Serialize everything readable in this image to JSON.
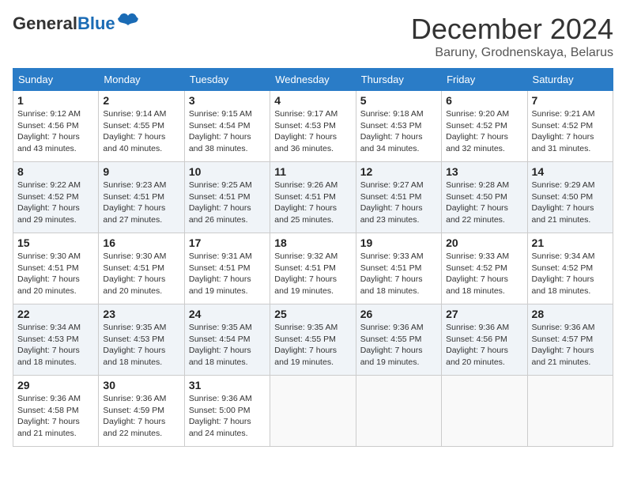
{
  "header": {
    "logo_general": "General",
    "logo_blue": "Blue",
    "month_title": "December 2024",
    "subtitle": "Baruny, Grodnenskaya, Belarus"
  },
  "days_of_week": [
    "Sunday",
    "Monday",
    "Tuesday",
    "Wednesday",
    "Thursday",
    "Friday",
    "Saturday"
  ],
  "weeks": [
    [
      {
        "day": "1",
        "sunrise": "9:12 AM",
        "sunset": "4:56 PM",
        "daylight": "7 hours and 43 minutes."
      },
      {
        "day": "2",
        "sunrise": "9:14 AM",
        "sunset": "4:55 PM",
        "daylight": "7 hours and 40 minutes."
      },
      {
        "day": "3",
        "sunrise": "9:15 AM",
        "sunset": "4:54 PM",
        "daylight": "7 hours and 38 minutes."
      },
      {
        "day": "4",
        "sunrise": "9:17 AM",
        "sunset": "4:53 PM",
        "daylight": "7 hours and 36 minutes."
      },
      {
        "day": "5",
        "sunrise": "9:18 AM",
        "sunset": "4:53 PM",
        "daylight": "7 hours and 34 minutes."
      },
      {
        "day": "6",
        "sunrise": "9:20 AM",
        "sunset": "4:52 PM",
        "daylight": "7 hours and 32 minutes."
      },
      {
        "day": "7",
        "sunrise": "9:21 AM",
        "sunset": "4:52 PM",
        "daylight": "7 hours and 31 minutes."
      }
    ],
    [
      {
        "day": "8",
        "sunrise": "9:22 AM",
        "sunset": "4:52 PM",
        "daylight": "7 hours and 29 minutes."
      },
      {
        "day": "9",
        "sunrise": "9:23 AM",
        "sunset": "4:51 PM",
        "daylight": "7 hours and 27 minutes."
      },
      {
        "day": "10",
        "sunrise": "9:25 AM",
        "sunset": "4:51 PM",
        "daylight": "7 hours and 26 minutes."
      },
      {
        "day": "11",
        "sunrise": "9:26 AM",
        "sunset": "4:51 PM",
        "daylight": "7 hours and 25 minutes."
      },
      {
        "day": "12",
        "sunrise": "9:27 AM",
        "sunset": "4:51 PM",
        "daylight": "7 hours and 23 minutes."
      },
      {
        "day": "13",
        "sunrise": "9:28 AM",
        "sunset": "4:50 PM",
        "daylight": "7 hours and 22 minutes."
      },
      {
        "day": "14",
        "sunrise": "9:29 AM",
        "sunset": "4:50 PM",
        "daylight": "7 hours and 21 minutes."
      }
    ],
    [
      {
        "day": "15",
        "sunrise": "9:30 AM",
        "sunset": "4:51 PM",
        "daylight": "7 hours and 20 minutes."
      },
      {
        "day": "16",
        "sunrise": "9:30 AM",
        "sunset": "4:51 PM",
        "daylight": "7 hours and 20 minutes."
      },
      {
        "day": "17",
        "sunrise": "9:31 AM",
        "sunset": "4:51 PM",
        "daylight": "7 hours and 19 minutes."
      },
      {
        "day": "18",
        "sunrise": "9:32 AM",
        "sunset": "4:51 PM",
        "daylight": "7 hours and 19 minutes."
      },
      {
        "day": "19",
        "sunrise": "9:33 AM",
        "sunset": "4:51 PM",
        "daylight": "7 hours and 18 minutes."
      },
      {
        "day": "20",
        "sunrise": "9:33 AM",
        "sunset": "4:52 PM",
        "daylight": "7 hours and 18 minutes."
      },
      {
        "day": "21",
        "sunrise": "9:34 AM",
        "sunset": "4:52 PM",
        "daylight": "7 hours and 18 minutes."
      }
    ],
    [
      {
        "day": "22",
        "sunrise": "9:34 AM",
        "sunset": "4:53 PM",
        "daylight": "7 hours and 18 minutes."
      },
      {
        "day": "23",
        "sunrise": "9:35 AM",
        "sunset": "4:53 PM",
        "daylight": "7 hours and 18 minutes."
      },
      {
        "day": "24",
        "sunrise": "9:35 AM",
        "sunset": "4:54 PM",
        "daylight": "7 hours and 18 minutes."
      },
      {
        "day": "25",
        "sunrise": "9:35 AM",
        "sunset": "4:55 PM",
        "daylight": "7 hours and 19 minutes."
      },
      {
        "day": "26",
        "sunrise": "9:36 AM",
        "sunset": "4:55 PM",
        "daylight": "7 hours and 19 minutes."
      },
      {
        "day": "27",
        "sunrise": "9:36 AM",
        "sunset": "4:56 PM",
        "daylight": "7 hours and 20 minutes."
      },
      {
        "day": "28",
        "sunrise": "9:36 AM",
        "sunset": "4:57 PM",
        "daylight": "7 hours and 21 minutes."
      }
    ],
    [
      {
        "day": "29",
        "sunrise": "9:36 AM",
        "sunset": "4:58 PM",
        "daylight": "7 hours and 21 minutes."
      },
      {
        "day": "30",
        "sunrise": "9:36 AM",
        "sunset": "4:59 PM",
        "daylight": "7 hours and 22 minutes."
      },
      {
        "day": "31",
        "sunrise": "9:36 AM",
        "sunset": "5:00 PM",
        "daylight": "7 hours and 24 minutes."
      },
      null,
      null,
      null,
      null
    ]
  ]
}
